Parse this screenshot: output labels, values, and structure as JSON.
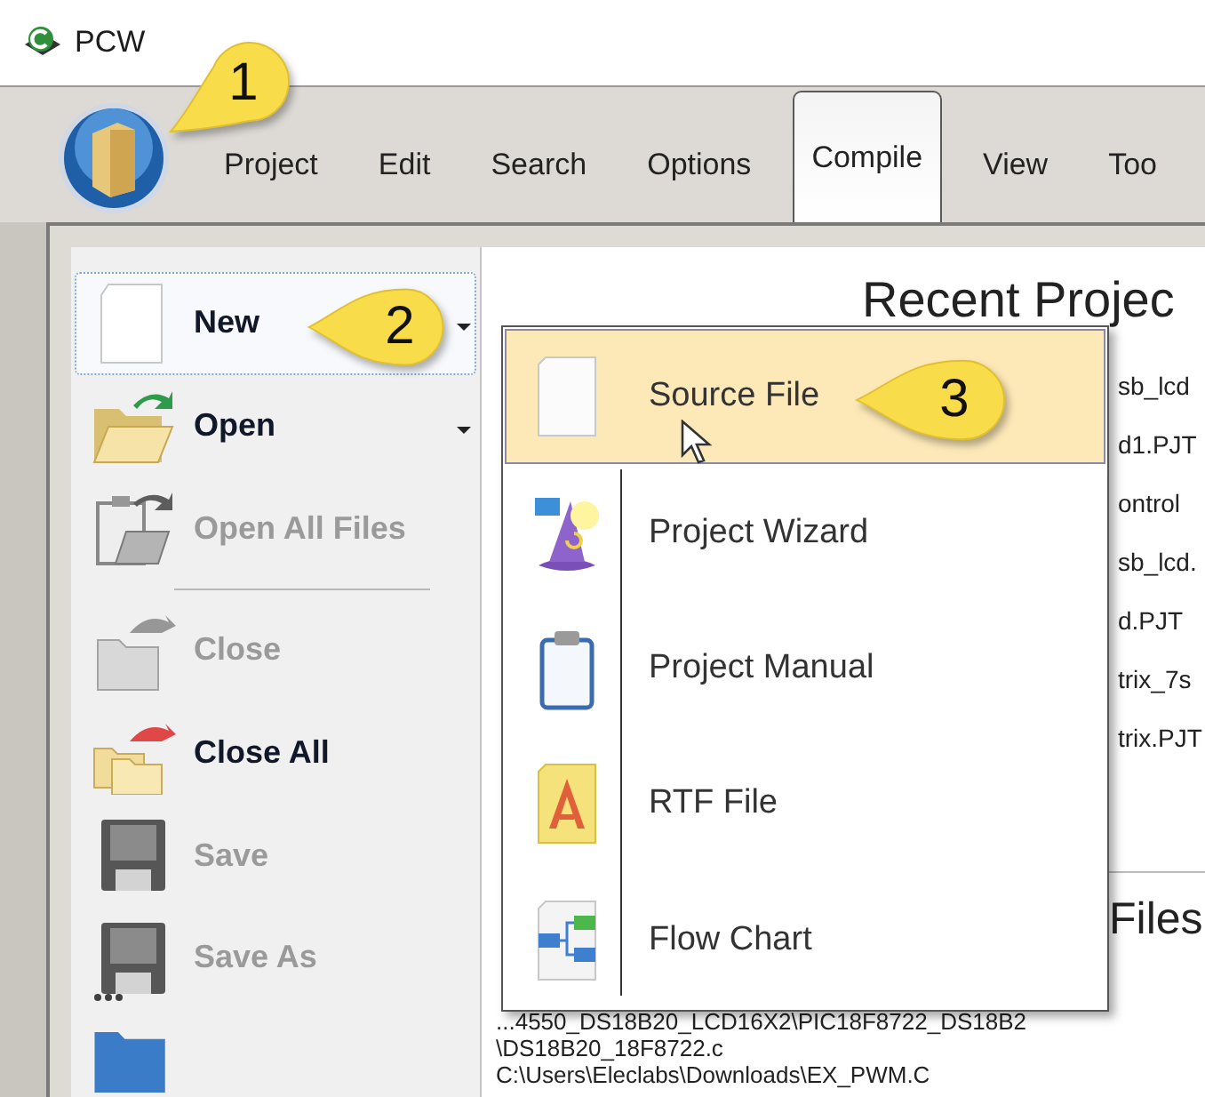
{
  "window": {
    "title": "PCW"
  },
  "ribbon_tabs": [
    {
      "label": "Project",
      "selected": false
    },
    {
      "label": "Edit",
      "selected": false
    },
    {
      "label": "Search",
      "selected": false
    },
    {
      "label": "Options",
      "selected": false
    },
    {
      "label": "Compile",
      "selected": true
    },
    {
      "label": "View",
      "selected": false
    },
    {
      "label": "Too",
      "selected": false
    }
  ],
  "app_menu": [
    {
      "label": "New",
      "selected": true,
      "disabled": false,
      "submenu": true
    },
    {
      "label": "Open",
      "selected": false,
      "disabled": false,
      "submenu": true
    },
    {
      "label": "Open All Files",
      "selected": false,
      "disabled": true,
      "submenu": false
    },
    {
      "label": "Close",
      "selected": false,
      "disabled": true,
      "submenu": false
    },
    {
      "label": "Close All",
      "selected": false,
      "disabled": false,
      "submenu": false
    },
    {
      "label": "Save",
      "selected": false,
      "disabled": true,
      "submenu": false
    },
    {
      "label": "Save As",
      "selected": false,
      "disabled": true,
      "submenu": false
    }
  ],
  "recent_projects": {
    "heading": "Recent Projec",
    "items": [
      "sb_lcd",
      "d1.PJT",
      "ontrol",
      "sb_lcd.",
      "d.PJT",
      "trix_7s",
      "trix.PJT"
    ]
  },
  "recent_files": {
    "heading": "Files",
    "items": [
      "...4550_DS18B20_LCD16X2\\PIC18F8722_DS18B2",
      "\\DS18B20_18F8722.c",
      "C:\\Users\\Eleclabs\\Downloads\\EX_PWM.C"
    ]
  },
  "new_submenu": [
    {
      "label": "Source File",
      "selected": true
    },
    {
      "label": "Project Wizard",
      "selected": false
    },
    {
      "label": "Project Manual",
      "selected": false
    },
    {
      "label": "RTF File",
      "selected": false
    },
    {
      "label": "Flow Chart",
      "selected": false
    }
  ],
  "callouts": [
    "1",
    "2",
    "3"
  ]
}
